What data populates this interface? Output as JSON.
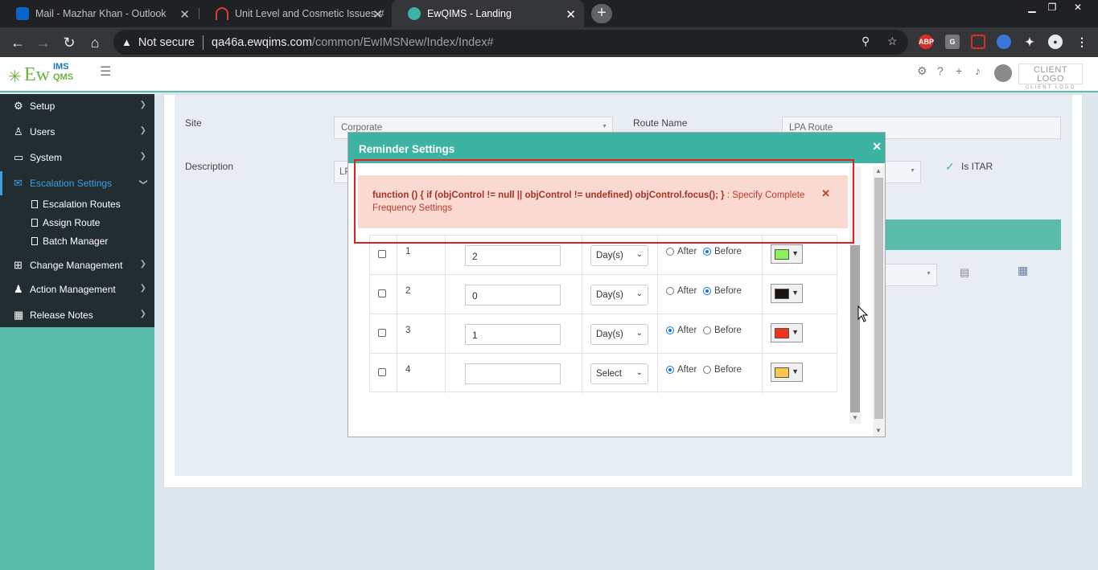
{
  "browser": {
    "tabs": [
      {
        "label": "Mail - Mazhar Khan - Outlook",
        "active": false
      },
      {
        "label": "Unit Level and Cosmetic Issues #",
        "active": false
      },
      {
        "label": "EwQIMS - Landing",
        "active": true
      }
    ],
    "security_label": "Not secure",
    "url_host": "qa46a.ewqims.com",
    "url_path": "/common/EwIMSNew/Index/Index#",
    "extensions": [
      "ABP",
      "G"
    ]
  },
  "app": {
    "logo_text": "Ew",
    "logo_ims": "IMS",
    "logo_qms": "QMS",
    "client_logo": "CLIENT LOGO",
    "client_logo_sub": "CLIENT LOGO"
  },
  "sidebar": {
    "items": [
      {
        "label": "Setup",
        "icon": "gear-icon"
      },
      {
        "label": "Users",
        "icon": "user-icon"
      },
      {
        "label": "System",
        "icon": "monitor-icon"
      },
      {
        "label": "Escalation Settings",
        "icon": "envelope-icon",
        "active": true
      },
      {
        "label": "Change Management",
        "icon": "sitemap-icon"
      },
      {
        "label": "Action Management",
        "icon": "user-check-icon"
      },
      {
        "label": "Release Notes",
        "icon": "building-icon"
      }
    ],
    "subitems": [
      "Escalation Routes",
      "Assign Route",
      "Batch Manager"
    ]
  },
  "form": {
    "site_label": "Site",
    "site_value": "Corporate",
    "route_name_label": "Route Name",
    "route_name_value": "LPA Route",
    "description_label": "Description",
    "description_value": "LP",
    "is_itar_label": "Is ITAR"
  },
  "modal": {
    "title": "Reminder Settings",
    "rows": [
      {
        "index": "1",
        "value": "2",
        "unit": "Day(s)",
        "timing": "Before",
        "color": "#8cf05a"
      },
      {
        "index": "2",
        "value": "0",
        "unit": "Day(s)",
        "timing": "Before",
        "color": "#1c140c"
      },
      {
        "index": "3",
        "value": "1",
        "unit": "Day(s)",
        "timing": "After",
        "color": "#f0341c"
      },
      {
        "index": "4",
        "value": "",
        "unit": "Select",
        "timing": "After",
        "color": "#f5c850"
      }
    ],
    "after_label": "After",
    "before_label": "Before"
  },
  "alert": {
    "code": "function () { if (objControl != null || objControl != undefined) objControl.focus(); }",
    "message": " : Specify Complete Frequency Settings"
  },
  "colors": {
    "teal": "#5bbcab",
    "modal_header": "#3db3a3",
    "sidebar_dark": "#222d32",
    "alert_bg": "#fadad0",
    "highlight_red": "#e02020"
  }
}
